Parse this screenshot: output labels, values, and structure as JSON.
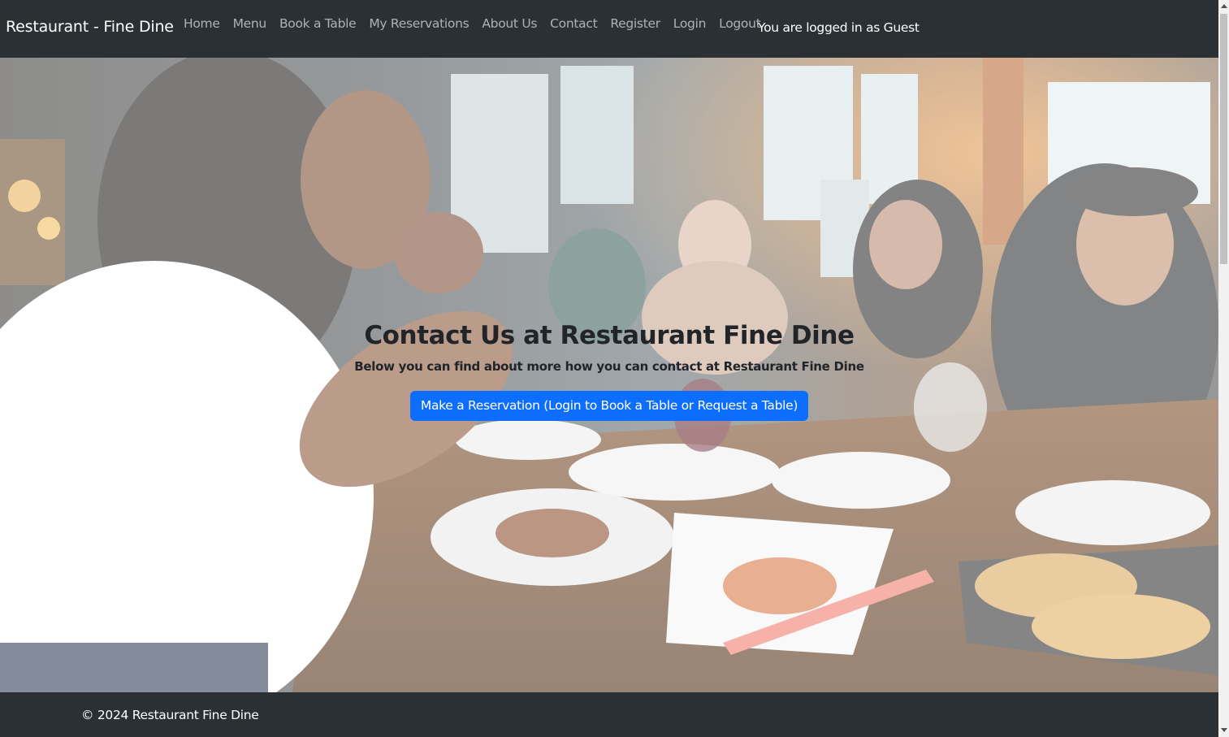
{
  "navbar": {
    "brand": "Restaurant - Fine Dine",
    "links": [
      {
        "label": "Home"
      },
      {
        "label": "Menu"
      },
      {
        "label": "Book a Table"
      },
      {
        "label": "My Reservations"
      },
      {
        "label": "About Us"
      },
      {
        "label": "Contact"
      },
      {
        "label": "Register"
      },
      {
        "label": "Login"
      },
      {
        "label": "Logout"
      }
    ],
    "login_status": "You are logged in as Guest"
  },
  "hero": {
    "background_image": "restaurant-dining-photo",
    "title": "Contact Us at Restaurant Fine Dine",
    "subtitle": "Below you can find about more how you can contact at Restaurant Fine Dine",
    "cta_label": "Make a Reservation (Login to Book a Table or Request a Table)"
  },
  "footer": {
    "copyright": "© 2024 Restaurant Fine Dine"
  },
  "colors": {
    "navbar_bg": "#2b3035",
    "primary_button": "#0d6efd",
    "text_dark": "#212529"
  }
}
